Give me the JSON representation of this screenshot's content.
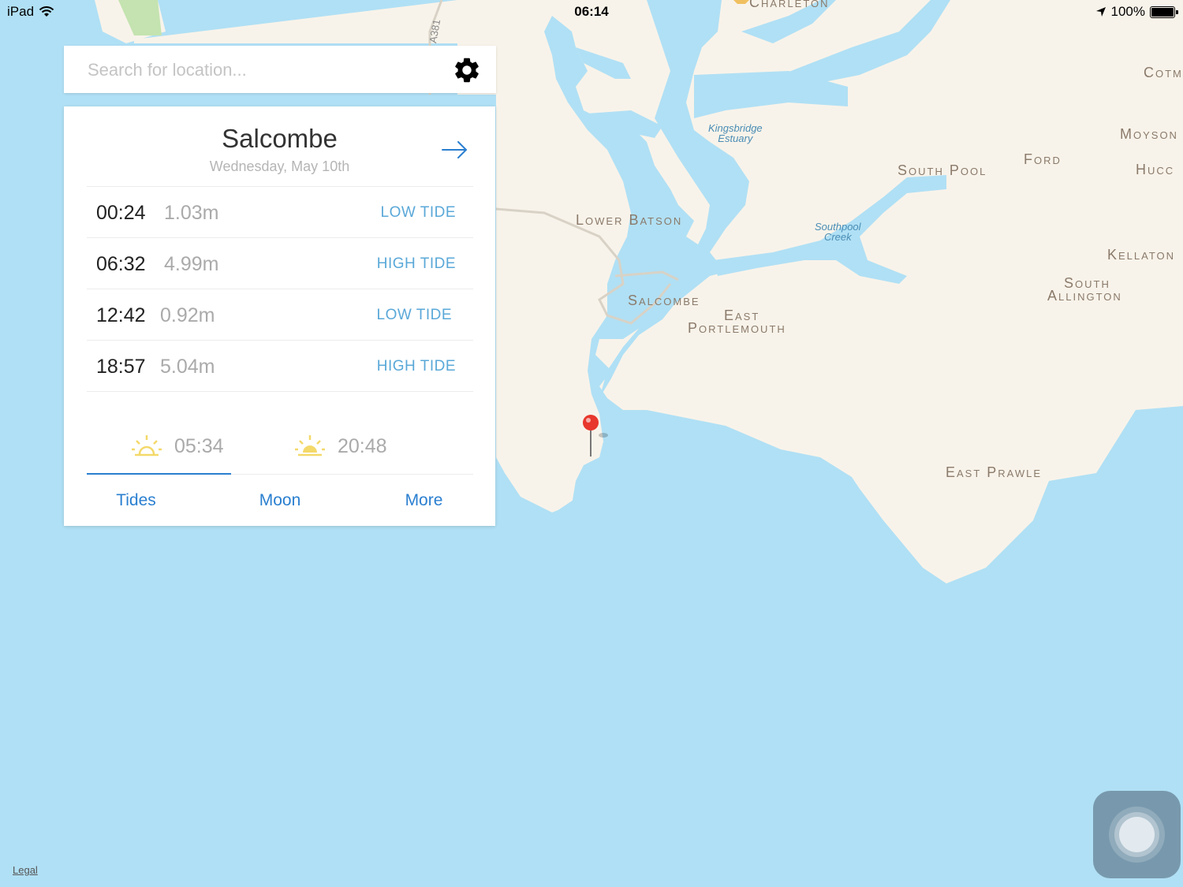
{
  "status_bar": {
    "device": "iPad",
    "time": "06:14",
    "battery": "100%"
  },
  "search": {
    "placeholder": "Search for location..."
  },
  "card": {
    "location": "Salcombe",
    "date": "Wednesday, May 10th",
    "tides": [
      {
        "time": "00:24",
        "height": "1.03m",
        "type": "LOW TIDE"
      },
      {
        "time": "06:32",
        "height": "4.99m",
        "type": "HIGH TIDE"
      },
      {
        "time": "12:42",
        "height": "0.92m",
        "type": "LOW TIDE"
      },
      {
        "time": "18:57",
        "height": "5.04m",
        "type": "HIGH TIDE"
      }
    ],
    "sunrise": "05:34",
    "sunset": "20:48",
    "tabs": [
      "Tides",
      "Moon",
      "More"
    ],
    "active_tab": "Tides"
  },
  "map": {
    "place_labels": {
      "charleton": "Charleton",
      "cotm": "Cotm",
      "moyson": "Moyson",
      "hucc": "Hucc",
      "ford": "Ford",
      "south_pool": "South Pool",
      "lower_batson": "Lower Batson",
      "salcombe": "Salcombe",
      "east": "East",
      "portlemouth": "Portlemouth",
      "kellaton": "Kellaton",
      "south": "South",
      "allington": "Allington",
      "east_prawle": "East Prawle"
    },
    "water_labels": {
      "kingsbridge": "Kingsbridge\nEstuary",
      "southpool": "Southpool\nCreek"
    },
    "road_label": "A381",
    "legal": "Legal"
  },
  "colors": {
    "water": "#b0e0f5",
    "land": "#f8f3ea",
    "accent": "#2a7fd0",
    "tide_type": "#5aa8d8",
    "pin": "#e8372c"
  }
}
